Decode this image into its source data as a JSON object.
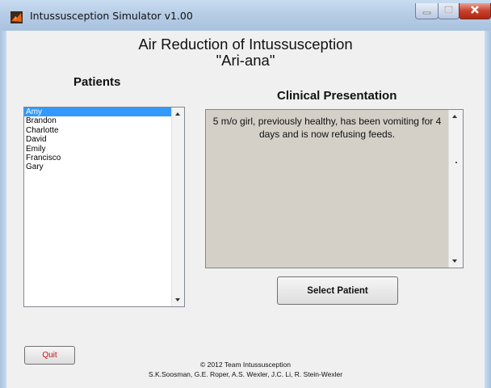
{
  "window": {
    "title": "Intussusception Simulator v1.00"
  },
  "app": {
    "title": "Air Reduction of Intussusception",
    "subtitle": "\"Ari-ana\""
  },
  "patients": {
    "heading": "Patients",
    "items": [
      "Amy",
      "Brandon",
      "Charlotte",
      "David",
      "Emily",
      "Francisco",
      "Gary"
    ],
    "selected": "Amy"
  },
  "clinical": {
    "heading": "Clinical Presentation",
    "text": "5 m/o girl, previously healthy, has been vomiting for 4 days and is now refusing feeds."
  },
  "buttons": {
    "select_patient": "Select Patient",
    "quit": "Quit"
  },
  "footer": {
    "copyright": "© 2012 Team Intussusception",
    "authors": "S.K.Soosman, G.E. Roper, A.S. Wexler, J.C. Li, R. Stein-Wexler"
  },
  "colors": {
    "selection": "#3399ff",
    "quit_text": "#cc1111",
    "text_area_bg": "#d4d0c8"
  },
  "icons": {
    "app": "matlab-icon"
  }
}
